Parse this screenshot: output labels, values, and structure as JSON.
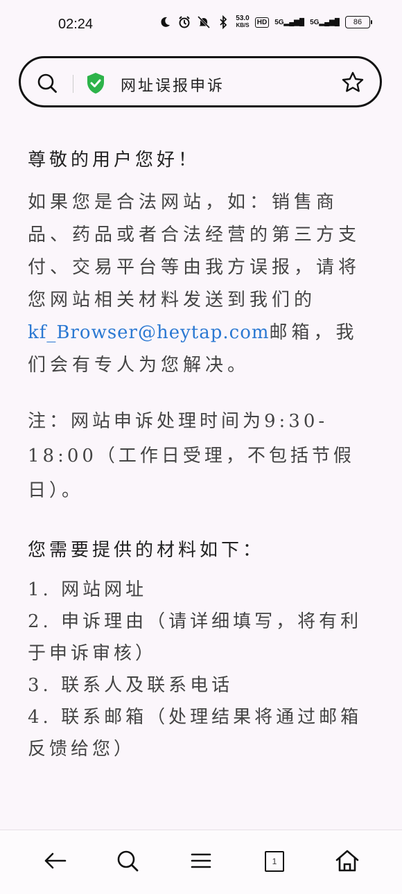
{
  "status_bar": {
    "time": "02:24",
    "net_speed_value": "53.0",
    "net_speed_unit": "KB/S",
    "hd_label": "HD",
    "signal1_label": "5G",
    "signal2_label": "5G",
    "battery_level": "86"
  },
  "search_bar": {
    "title": "网址误报申诉",
    "shield_color": "#2db34a"
  },
  "content": {
    "greeting": "尊敬的用户您好！",
    "paragraph_text": "如果您是合法网站，如：销售商品、药品或者合法经营的第三方支付、交易平台等由我方误报，请将您网站相关材料发送到我们的",
    "email": "kf_Browser@heytap.com",
    "paragraph_tail": "邮箱，我们会有专人为您解决。",
    "note": "注：网站申诉处理时间为9:30-18:00（工作日受理，不包括节假日）。",
    "needs_title": "您需要提供的材料如下：",
    "items": [
      "1. 网站网址",
      "2. 申诉理由（请详细填写，将有利于申诉审核）",
      "3. 联系人及联系电话",
      "4. 联系邮箱（处理结果将通过邮箱反馈给您）"
    ]
  },
  "bottom_nav": {
    "tabs_count": "1"
  }
}
